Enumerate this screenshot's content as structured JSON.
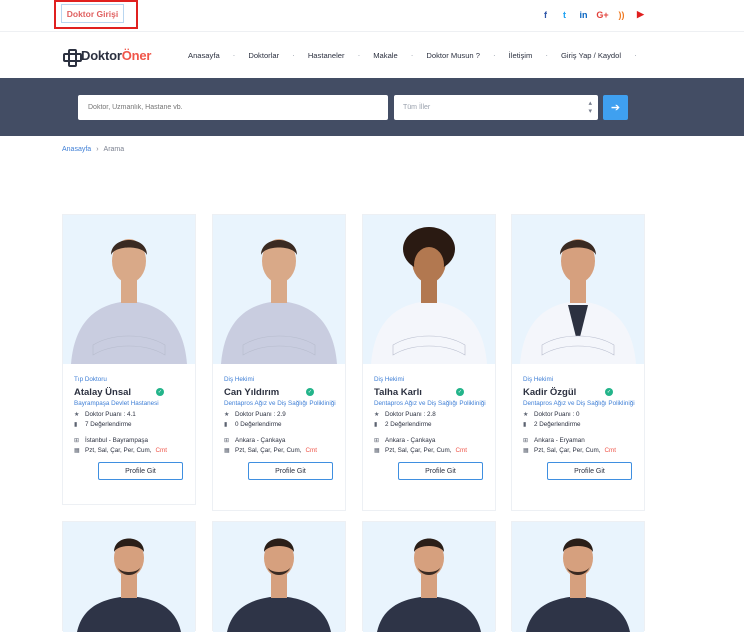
{
  "topbar": {
    "doctor_login": "Doktor Girişi",
    "social": [
      {
        "icon": "facebook-icon",
        "glyph": "f",
        "color": "#2f57a8"
      },
      {
        "icon": "twitter-icon",
        "glyph": "t",
        "color": "#1da1f2"
      },
      {
        "icon": "linkedin-icon",
        "glyph": "in",
        "color": "#0a66c2"
      },
      {
        "icon": "google-plus-icon",
        "glyph": "G+",
        "color": "#e2403a"
      },
      {
        "icon": "rss-icon",
        "glyph": "))",
        "color": "#f07a22"
      },
      {
        "icon": "youtube-icon",
        "glyph": "▶",
        "color": "#e01f1f"
      }
    ]
  },
  "header": {
    "logo_part1": "Doktor",
    "logo_part2": "Öner",
    "nav": [
      "Anasayfa",
      "Doktorlar",
      "Hastaneler",
      "Makale",
      "Doktor Musun ?",
      "İletişim",
      "Giriş Yap / Kaydol"
    ]
  },
  "search": {
    "placeholder": "Doktor, Uzmanlık, Hastane vb.",
    "city_value": "Tüm İller",
    "button_icon": "arrow-right-icon"
  },
  "breadcrumb": {
    "home": "Anasayfa",
    "current": "Arama"
  },
  "cards": [
    {
      "specialty": "Tıp Doktoru",
      "name": "Atalay Ünsal",
      "hospital": "Bayrampaşa Devlet Hastanesi",
      "score": "Doktor Puanı : 4.1",
      "reviews": "7 Değerlendirme",
      "location": "İstanbul - Bayrampaşa",
      "days": "Pzt, Sal, Çar, Per, Cum,",
      "days_weekend": "Cmt",
      "button": "Profile Git"
    },
    {
      "specialty": "Diş Hekimi",
      "name": "Can Yıldırım",
      "hospital": "Dentapros Ağız ve Diş Sağlığı Polikliniği",
      "score": "Doktor Puanı : 2.9",
      "reviews": "0 Değerlendirme",
      "location": "Ankara - Çankaya",
      "days": "Pzt, Sal, Çar, Per, Cum,",
      "days_weekend": "Cmt",
      "button": "Profile Git"
    },
    {
      "specialty": "Diş Hekimi",
      "name": "Talha Karlı",
      "hospital": "Dentapros Ağız ve Diş Sağlığı Polikliniği",
      "score": "Doktor Puanı : 2.8",
      "reviews": "2 Değerlendirme",
      "location": "Ankara - Çankaya",
      "days": "Pzt, Sal, Çar, Per, Cum,",
      "days_weekend": "Cmt",
      "button": "Profile Git"
    },
    {
      "specialty": "Diş Hekimi",
      "name": "Kadir Özgül",
      "hospital": "Dentapros Ağız ve Diş Sağlığı Polikliniği",
      "score": "Doktor Puanı : 0",
      "reviews": "2 Değerlendirme",
      "location": "Ankara - Eryaman",
      "days": "Pzt, Sal, Çar, Per, Cum,",
      "days_weekend": "Cmt",
      "button": "Profile Git"
    }
  ],
  "colors": {
    "accent": "#3f7fd6",
    "brand": "#f0564a",
    "search_band": "#434d64",
    "verified": "#23b48a"
  }
}
